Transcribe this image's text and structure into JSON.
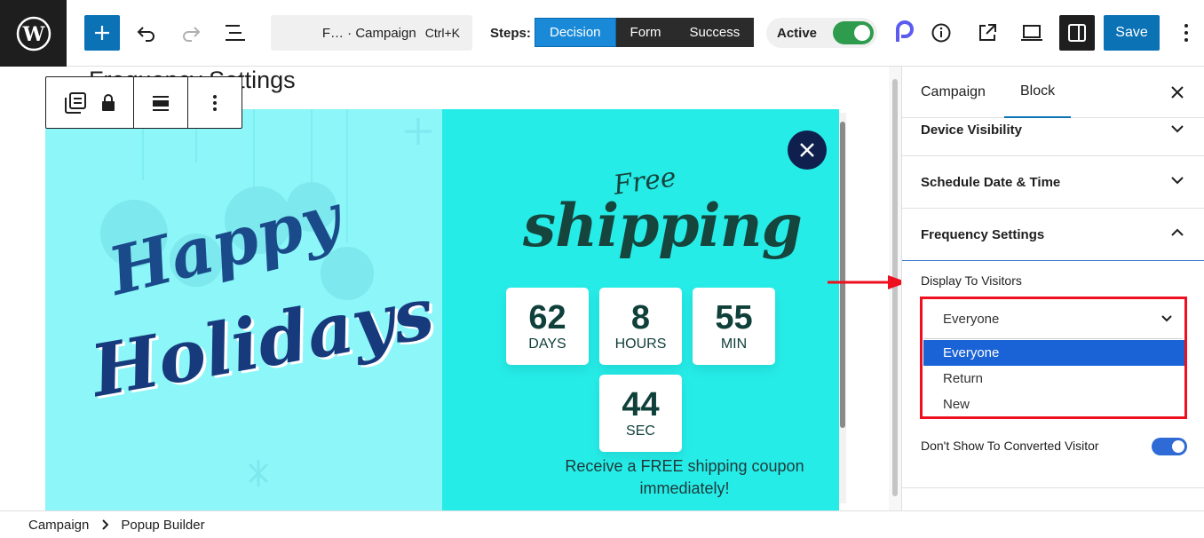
{
  "toolbar": {
    "command_text": "F… · Campaign",
    "command_shortcut": "Ctrl+K",
    "steps_label": "Steps:",
    "steps": [
      "Decision",
      "Form",
      "Success"
    ],
    "active_step": "Decision",
    "active_label": "Active",
    "active_on": true,
    "save_label": "Save"
  },
  "canvas": {
    "doc_title": "Frequency Settings",
    "popup": {
      "happy": "Happy",
      "holidays": "Holidays",
      "free": "Free",
      "shipping": "shipping",
      "countdown": [
        {
          "num": "62",
          "unit": "DAYS"
        },
        {
          "num": "8",
          "unit": "HOURS"
        },
        {
          "num": "55",
          "unit": "MIN"
        },
        {
          "num": "44",
          "unit": "SEC"
        }
      ],
      "promo_line1": "Receive a FREE shipping coupon",
      "promo_line2": "immediately!",
      "colors": {
        "left_bg": "#8cf6f8",
        "right_bg": "#26ece8",
        "text_dark": "#16453e"
      }
    }
  },
  "sidebar": {
    "tabs": [
      "Campaign",
      "Block"
    ],
    "selected_tab": "Block",
    "panels": [
      "Device Visibility",
      "Schedule Date & Time",
      "Frequency Settings"
    ],
    "display_to_visitors_label": "Display To Visitors",
    "select_value": "Everyone",
    "options": [
      "Everyone",
      "Return",
      "New"
    ],
    "highlighted_option": "Everyone",
    "dont_show_label": "Don't Show To Converted Visitor",
    "dont_show_on": true
  },
  "footer": {
    "breadcrumb": [
      "Campaign",
      "Popup Builder"
    ]
  },
  "accent_colors": {
    "wp_blue": "#0a72b5",
    "toggle_green": "#2e9b4d",
    "annotation_red": "#ee0f1f"
  }
}
